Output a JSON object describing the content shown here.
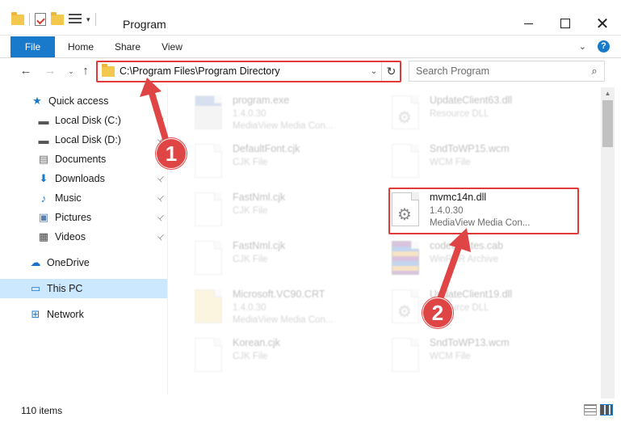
{
  "window": {
    "title": "Program",
    "qat_dropdown": "▾",
    "controls": {
      "minimize": "",
      "maximize": "",
      "close": "✕"
    }
  },
  "ribbon": {
    "tabs": [
      "File",
      "Home",
      "Share",
      "View"
    ],
    "expand_glyph": "⌄",
    "help_glyph": "?"
  },
  "nav": {
    "back": "←",
    "forward": "→",
    "recent": "⌄",
    "up": "↑"
  },
  "address": {
    "path": "C:\\Program Files\\Program Directory",
    "dropdown": "⌄",
    "refresh": "↻"
  },
  "search": {
    "placeholder": "Search Program",
    "icon": "⌕"
  },
  "sidebar": {
    "items": [
      {
        "label": "Quick access",
        "icon": "star-icon",
        "glyph": "★",
        "color": "#1979ca",
        "pinned": false
      },
      {
        "label": "Local Disk (C:)",
        "icon": "drive-icon",
        "glyph": "▬",
        "color": "#555555",
        "pinned": true
      },
      {
        "label": "Local Disk (D:)",
        "icon": "drive-icon",
        "glyph": "▬",
        "color": "#555555",
        "pinned": true
      },
      {
        "label": "Documents",
        "icon": "documents-icon",
        "glyph": "▤",
        "color": "#6d6d6d",
        "pinned": true
      },
      {
        "label": "Downloads",
        "icon": "download-icon",
        "glyph": "⬇",
        "color": "#1979ca",
        "pinned": true
      },
      {
        "label": "Music",
        "icon": "music-icon",
        "glyph": "♪",
        "color": "#1979ca",
        "pinned": true
      },
      {
        "label": "Pictures",
        "icon": "pictures-icon",
        "glyph": "▣",
        "color": "#5a7fb0",
        "pinned": true
      },
      {
        "label": "Videos",
        "icon": "videos-icon",
        "glyph": "▦",
        "color": "#444444",
        "pinned": true
      },
      {
        "label": "OneDrive",
        "icon": "cloud-icon",
        "glyph": "☁",
        "color": "#1a6fc9",
        "pinned": false
      },
      {
        "label": "This PC",
        "icon": "computer-icon",
        "glyph": "▭",
        "color": "#1979ca",
        "pinned": false,
        "selected": true
      },
      {
        "label": "Network",
        "icon": "network-icon",
        "glyph": "⊞",
        "color": "#1979ca",
        "pinned": false
      }
    ],
    "pin_glyph": "📌"
  },
  "files": [
    {
      "name": "program.exe",
      "line1": "1.4.0.30",
      "line2": "MediaView Media Con...",
      "icon": "exe",
      "faded": true
    },
    {
      "name": "UpdateClient63.dll",
      "line1": "Resource DLL",
      "line2": "",
      "icon": "gear",
      "faded": true
    },
    {
      "name": "DefaultFont.cjk",
      "line1": "CJK File",
      "line2": "",
      "icon": "blank",
      "faded": true
    },
    {
      "name": "SndToWP15.wcm",
      "line1": "WCM File",
      "line2": "",
      "icon": "blank",
      "faded": true
    },
    {
      "name": "FastNml.cjk",
      "line1": "CJK File",
      "line2": "",
      "icon": "blank",
      "faded": true
    },
    {
      "name": "mvmc14n.dll",
      "line1": "1.4.0.30",
      "line2": "MediaView Media Con...",
      "icon": "gear",
      "faded": false
    },
    {
      "name": "FastNml.cjk",
      "line1": "CJK File",
      "line2": "",
      "icon": "blank",
      "faded": true
    },
    {
      "name": "codecsrates.cab",
      "line1": "WinRAR Archive",
      "line2": "",
      "icon": "rar",
      "faded": true
    },
    {
      "name": "Microsoft.VC90.CRT",
      "line1": "1.4.0.30",
      "line2": "MediaView Media Con...",
      "icon": "crt",
      "faded": true
    },
    {
      "name": "UpdateClient19.dll",
      "line1": "Resource DLL",
      "line2": "",
      "icon": "gear",
      "faded": true
    },
    {
      "name": "Korean.cjk",
      "line1": "CJK File",
      "line2": "",
      "icon": "blank",
      "faded": true
    },
    {
      "name": "SndToWP13.wcm",
      "line1": "WCM File",
      "line2": "",
      "icon": "blank",
      "faded": true
    }
  ],
  "scrollbar": {
    "up": "▲",
    "down": "▼"
  },
  "status": {
    "count": "110 items"
  },
  "annotations": {
    "step1": "1",
    "step2": "2",
    "color": "#e03a3a"
  }
}
